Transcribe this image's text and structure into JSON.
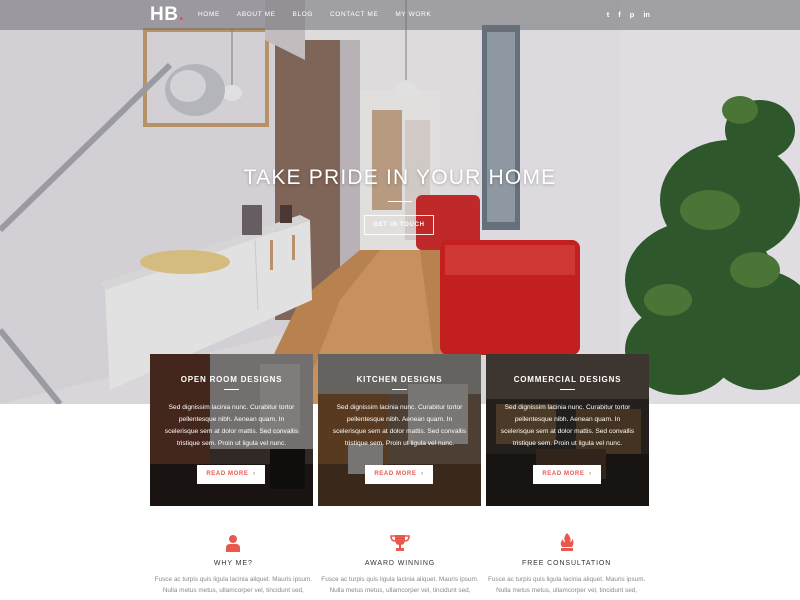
{
  "nav": {
    "logo": "HB",
    "logo_dot": ".",
    "links": [
      "HOME",
      "ABOUT ME",
      "BLOG",
      "CONTACT ME",
      "MY WORK"
    ],
    "social_icons": [
      "twitter-icon",
      "facebook-icon",
      "pinterest-icon",
      "linkedin-icon"
    ],
    "social_glyphs": [
      "t",
      "f",
      "p",
      "in"
    ]
  },
  "hero": {
    "title": "TAKE PRIDE IN YOUR HOME",
    "button": "GET IN TOUCH"
  },
  "cards": [
    {
      "title": "OPEN ROOM DESIGNS",
      "text": "Sed dignissim lacinia nunc. Curabitur tortor pellentesque nibh. Aenean quam. In scelerisque sem at dolor mattis. Sed convallis tristique sem. Proin ut ligula vel nunc.",
      "button": "READ MORE"
    },
    {
      "title": "KITCHEN DESIGNS",
      "text": "Sed dignissim lacinia nunc. Curabitur tortor pellentesque nibh. Aenean quam. In scelerisque sem at dolor mattis. Sed convallis tristique sem. Proin ut ligula vel nunc.",
      "button": "READ MORE"
    },
    {
      "title": "COMMERCIAL DESIGNS",
      "text": "Sed dignissim lacinia nunc. Curabitur tortor pellentesque nibh. Aenean quam. In scelerisque sem at dolor mattis. Sed convallis tristique sem. Proin ut ligula vel nunc.",
      "button": "READ MORE"
    }
  ],
  "features": [
    {
      "title": "WHY ME?",
      "icon": "person-icon",
      "text": "Fusce ac turpis quis ligula lacinia aliquet. Mauris ipsum. Nulla metus metus, ullamcorper vel, tincidunt sed,"
    },
    {
      "title": "AWARD WINNING",
      "icon": "trophy-icon",
      "text": "Fusce ac turpis quis ligula lacinia aliquet. Mauris ipsum. Nulla metus metus, ullamcorper vel, tincidunt sed,"
    },
    {
      "title": "FREE CONSULTATION",
      "icon": "flame-icon",
      "text": "Fusce ac turpis quis ligula lacinia aliquet. Mauris ipsum. Nulla metus metus, ullamcorper vel, tincidunt sed,"
    }
  ],
  "colors": {
    "accent": "#e8584f",
    "nav_bg": "#6e6e73",
    "text_dark": "#333333",
    "text_muted": "#8a8a8a"
  }
}
